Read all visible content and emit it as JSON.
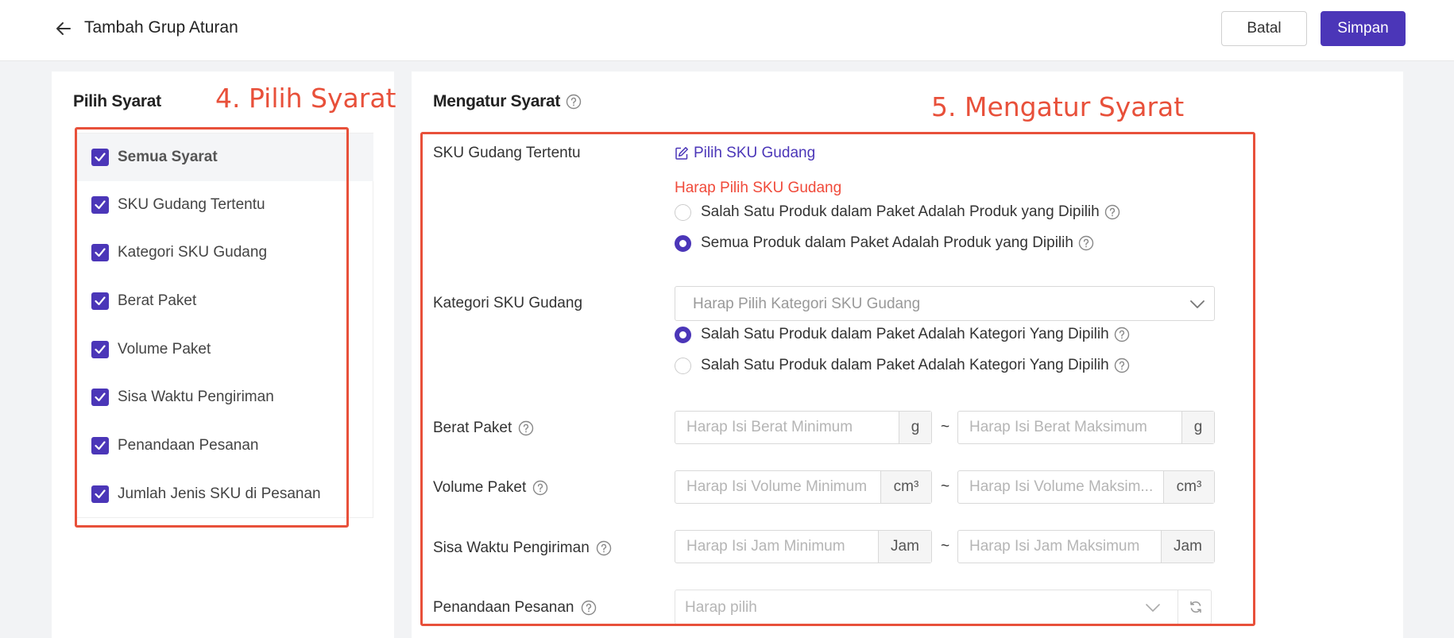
{
  "header": {
    "title": "Tambah Grup Aturan",
    "cancel_label": "Batal",
    "save_label": "Simpan"
  },
  "colors": {
    "accent": "#4b36b8",
    "annotation": "#e8503a",
    "error": "#f04a3a"
  },
  "left": {
    "title": "Pilih Syarat",
    "annotation": "4. Pilih Syarat",
    "items": [
      {
        "label": "Semua Syarat",
        "checked": true
      },
      {
        "label": "SKU Gudang Tertentu",
        "checked": true
      },
      {
        "label": "Kategori SKU Gudang",
        "checked": true
      },
      {
        "label": "Berat Paket",
        "checked": true
      },
      {
        "label": "Volume Paket",
        "checked": true
      },
      {
        "label": "Sisa Waktu Pengiriman",
        "checked": true
      },
      {
        "label": "Penandaan Pesanan",
        "checked": true
      },
      {
        "label": "Jumlah Jenis SKU di Pesanan",
        "checked": true
      }
    ]
  },
  "right": {
    "title": "Mengatur Syarat",
    "annotation": "5. Mengatur Syarat",
    "sku": {
      "label": "SKU Gudang Tertentu",
      "link": "Pilih SKU Gudang",
      "error": "Harap Pilih SKU Gudang",
      "options": [
        {
          "label": "Salah Satu Produk dalam Paket Adalah Produk yang Dipilih",
          "selected": false
        },
        {
          "label": "Semua Produk dalam Paket Adalah Produk yang Dipilih",
          "selected": true
        }
      ]
    },
    "category": {
      "label": "Kategori SKU Gudang",
      "placeholder": "Harap Pilih Kategori SKU Gudang",
      "options": [
        {
          "label": "Salah Satu Produk dalam Paket Adalah Kategori Yang Dipilih",
          "selected": true
        },
        {
          "label": "Salah Satu Produk dalam Paket Adalah Kategori Yang Dipilih",
          "selected": false
        }
      ]
    },
    "weight": {
      "label": "Berat Paket",
      "min_placeholder": "Harap Isi Berat Minimum",
      "max_placeholder": "Harap Isi Berat Maksimum",
      "unit": "g",
      "separator": "~"
    },
    "volume": {
      "label": "Volume Paket",
      "min_placeholder": "Harap Isi Volume Minimum",
      "max_placeholder": "Harap Isi Volume Maksim...",
      "unit": "cm³",
      "separator": "~"
    },
    "time": {
      "label": "Sisa Waktu Pengiriman",
      "min_placeholder": "Harap Isi Jam Minimum",
      "max_placeholder": "Harap Isi Jam Maksimum",
      "unit": "Jam",
      "separator": "~"
    },
    "tag": {
      "label": "Penandaan Pesanan",
      "placeholder": "Harap pilih"
    }
  }
}
